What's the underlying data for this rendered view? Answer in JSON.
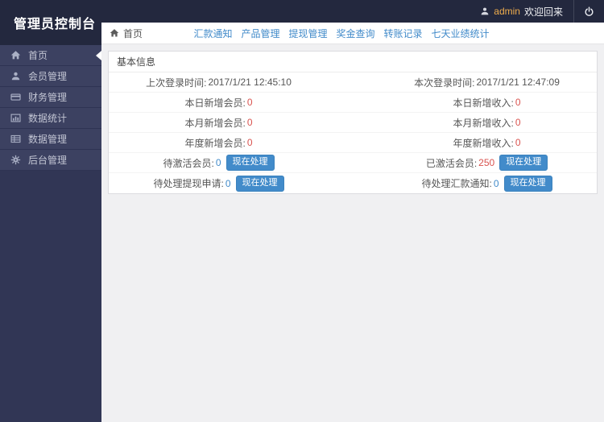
{
  "app": {
    "title": "管理员控制台"
  },
  "topbar": {
    "user_icon": "person-icon",
    "username": "admin",
    "welcome": "欢迎回来",
    "logout_icon": "power-icon"
  },
  "sidebar": {
    "items": [
      {
        "key": "home",
        "label": "首页",
        "icon": "home-icon",
        "active": true
      },
      {
        "key": "members",
        "label": "会员管理",
        "icon": "user-icon",
        "active": false
      },
      {
        "key": "finance",
        "label": "财务管理",
        "icon": "credit-card-icon",
        "active": false
      },
      {
        "key": "statistics",
        "label": "数据统计",
        "icon": "bar-chart-icon",
        "active": false
      },
      {
        "key": "data",
        "label": "数据管理",
        "icon": "table-icon",
        "active": false
      },
      {
        "key": "admin",
        "label": "后台管理",
        "icon": "cogs-icon",
        "active": false
      }
    ]
  },
  "breadcrumb": {
    "icon": "home-icon",
    "label": "首页"
  },
  "nav_links": [
    {
      "key": "remittance-notice",
      "label": "汇款通知"
    },
    {
      "key": "products",
      "label": "产品管理"
    },
    {
      "key": "withdrawals",
      "label": "提现管理"
    },
    {
      "key": "bonus-query",
      "label": "奖金查询"
    },
    {
      "key": "transfer-records",
      "label": "转账记录"
    },
    {
      "key": "seven-day-stats",
      "label": "七天业绩统计"
    }
  ],
  "panel": {
    "title": "基本信息",
    "button_label": "现在处理",
    "rows": [
      {
        "left": {
          "label": "上次登录时间:",
          "value": "2017/1/21 12:45:10",
          "color": "dark"
        },
        "right": {
          "label": "本次登录时间:",
          "value": "2017/1/21 12:47:09",
          "color": "dark"
        }
      },
      {
        "left": {
          "label": "本日新增会员:",
          "value": "0",
          "color": "red"
        },
        "right": {
          "label": "本日新增收入:",
          "value": "0",
          "color": "red"
        }
      },
      {
        "left": {
          "label": "本月新增会员:",
          "value": "0",
          "color": "red"
        },
        "right": {
          "label": "本月新增收入:",
          "value": "0",
          "color": "red"
        }
      },
      {
        "left": {
          "label": "年度新增会员:",
          "value": "0",
          "color": "red"
        },
        "right": {
          "label": "年度新增收入:",
          "value": "0",
          "color": "red"
        }
      },
      {
        "left": {
          "label": "待激活会员:",
          "value": "0",
          "color": "blue",
          "button": "现在处理"
        },
        "right": {
          "label": "已激活会员:",
          "value": "250",
          "color": "red",
          "button": "现在处理"
        }
      },
      {
        "left": {
          "label": "待处理提现申请:",
          "value": "0",
          "color": "blue",
          "button": "现在处理"
        },
        "right": {
          "label": "待处理汇款通知:",
          "value": "0",
          "color": "blue",
          "button": "现在处理"
        }
      }
    ]
  },
  "colors": {
    "accent_blue": "#428bca",
    "danger_red": "#d9534f",
    "sidebar_bg": "#313655",
    "topbar_bg": "#23283e",
    "username_orange": "#efad4d",
    "content_bg": "#f0f0f2"
  }
}
